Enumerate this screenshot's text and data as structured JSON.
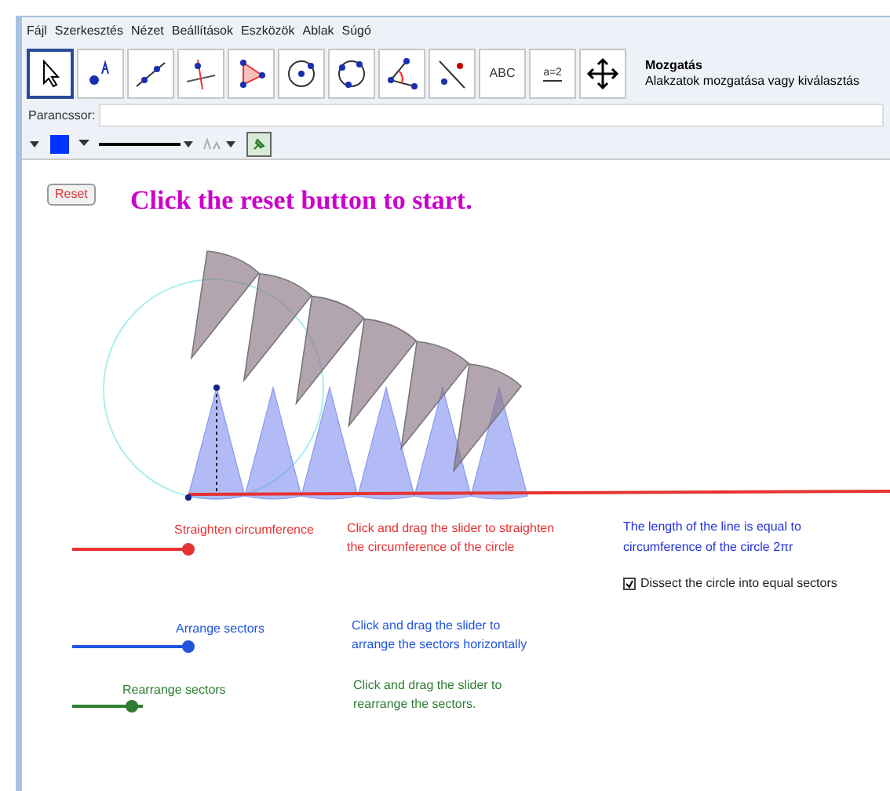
{
  "menu": [
    "Fájl",
    "Szerkesztés",
    "Nézet",
    "Beállítások",
    "Eszközök",
    "Ablak",
    "Súgó"
  ],
  "tools": [
    {
      "kind": "move",
      "selected": true
    },
    {
      "kind": "point",
      "selected": false
    },
    {
      "kind": "line",
      "selected": false
    },
    {
      "kind": "perpendicular",
      "selected": false
    },
    {
      "kind": "polygon",
      "selected": false
    },
    {
      "kind": "circle",
      "selected": false
    },
    {
      "kind": "conic",
      "selected": false
    },
    {
      "kind": "angle",
      "selected": false
    },
    {
      "kind": "reflect",
      "selected": false
    },
    {
      "kind": "text",
      "label": "ABC",
      "selected": false
    },
    {
      "kind": "slider",
      "label": "a=2",
      "selected": false
    },
    {
      "kind": "pan",
      "selected": false
    }
  ],
  "tool_help": {
    "title": "Mozgatás",
    "description": "Alakzatok mozgatása vagy kiválasztás"
  },
  "command_bar": {
    "label": "Parancssor:"
  },
  "style_bar": {
    "color": "#0033ff"
  },
  "canvas": {
    "reset_button": "Reset",
    "heading": "Click the reset button to start.",
    "sliders": [
      {
        "label": "Straighten circumference",
        "color": "#e53333",
        "level": 1,
        "hint": [
          "Click and drag the slider to straighten",
          "the circumference of the circle"
        ]
      },
      {
        "label": "Arrange sectors",
        "color": "#2255dd",
        "level": 1,
        "hint": [
          "Click and drag the slider to",
          "arrange the sectors horizontally"
        ]
      },
      {
        "label": "Rearrange sectors",
        "color": "#2e7d32",
        "level": 0.84,
        "hint": [
          "Click and drag the slider to",
          "rearrange the sectors."
        ]
      }
    ],
    "note": [
      "The length of the line is equal to",
      "circumference of the circle  2πr"
    ],
    "checkbox": {
      "label": "Dissect the circle into equal sectors",
      "checked": true
    }
  }
}
